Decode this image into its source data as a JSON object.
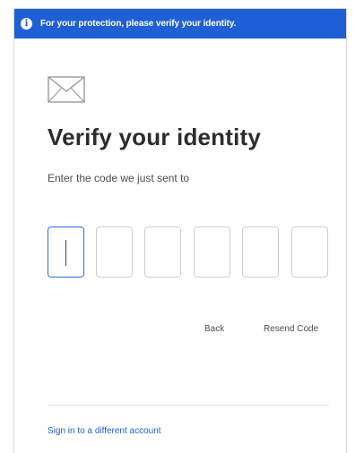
{
  "banner": {
    "icon": "info-icon",
    "text": "For your protection, please verify your identity."
  },
  "main": {
    "icon": "envelope-icon",
    "title": "Verify your identity",
    "subtitle": "Enter the code we just sent to",
    "code_inputs": [
      {
        "value": "",
        "focused": true
      },
      {
        "value": "",
        "focused": false
      },
      {
        "value": "",
        "focused": false
      },
      {
        "value": "",
        "focused": false
      },
      {
        "value": "",
        "focused": false
      },
      {
        "value": "",
        "focused": false
      }
    ]
  },
  "actions": {
    "back_label": "Back",
    "resend_label": "Resend Code"
  },
  "footer": {
    "switch_account_label": "Sign in to a different account"
  },
  "colors": {
    "banner_bg": "#1f5fd6",
    "link": "#1f5fd6",
    "focused_input_border": "#2b6ee0"
  }
}
